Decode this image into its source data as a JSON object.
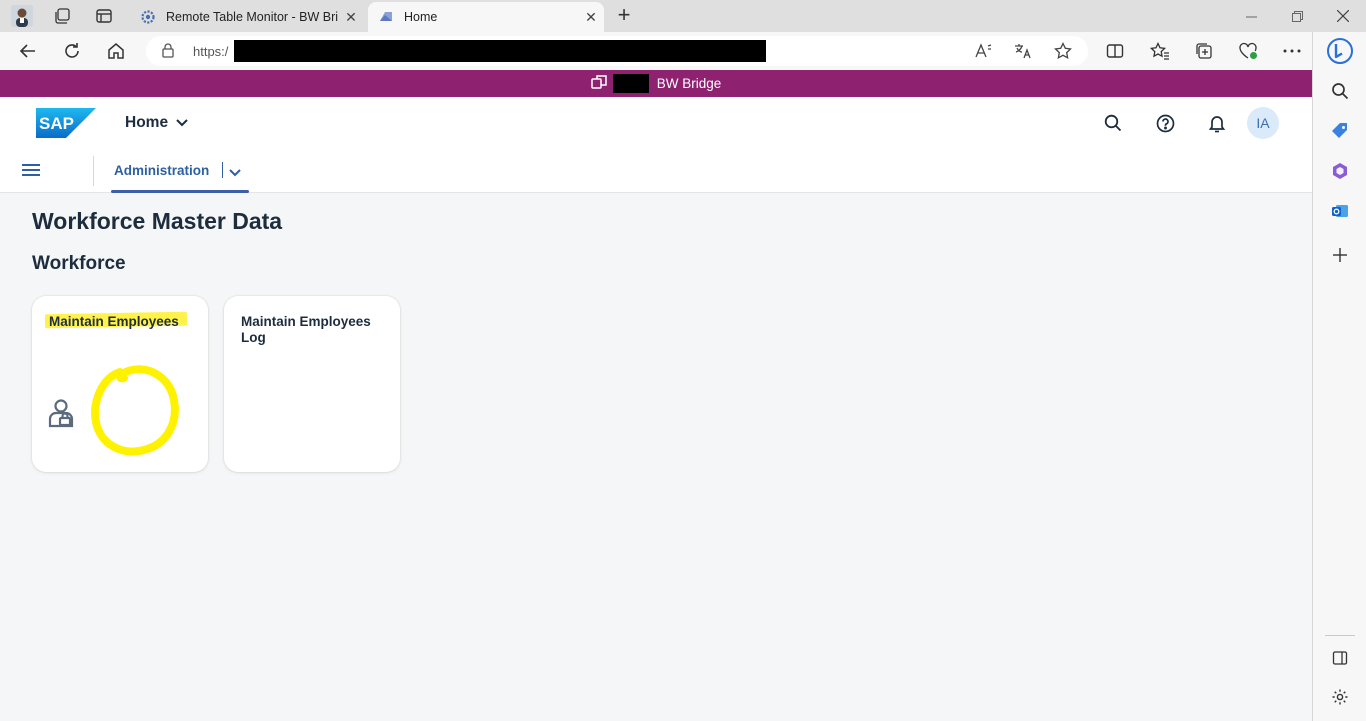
{
  "browser": {
    "tabs": [
      {
        "title": "Remote Table Monitor - BW Brid",
        "active": false
      },
      {
        "title": "Home",
        "active": true
      }
    ],
    "address": {
      "url_prefix": "https:/"
    }
  },
  "env_bar": {
    "title": "BW Bridge",
    "color": "#8e2271"
  },
  "shell": {
    "app_title": "Home",
    "avatar_initials": "IA"
  },
  "nav": {
    "active_tab": "Administration"
  },
  "page": {
    "title": "Workforce Master Data",
    "section": "Workforce",
    "tiles": [
      {
        "title": "Maintain Employees",
        "icon": "employee-lookup-icon"
      },
      {
        "title": "Maintain Employees Log"
      }
    ]
  },
  "colors": {
    "accent": "#3c5fa8",
    "highlight": "#fff24a"
  }
}
